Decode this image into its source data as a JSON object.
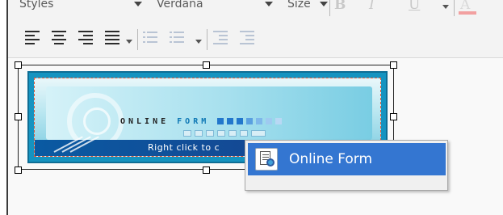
{
  "toolbar": {
    "styles_combo": "Styles",
    "font_combo": "Verdana",
    "size_combo": "Size",
    "bold": "B",
    "italic": "I",
    "underline": "U",
    "text_color": "A"
  },
  "banner": {
    "title_part1": "ONLINE",
    "title_part2": "FORM",
    "cta": "Right click to c"
  },
  "context_menu": {
    "items": [
      {
        "label": "Online Form",
        "icon": "form-properties-icon",
        "highlighted": true
      }
    ]
  },
  "colors": {
    "menu_highlight": "#3476d1",
    "banner_border": "#1593c0",
    "banner_footer": "#0a5aa2"
  }
}
